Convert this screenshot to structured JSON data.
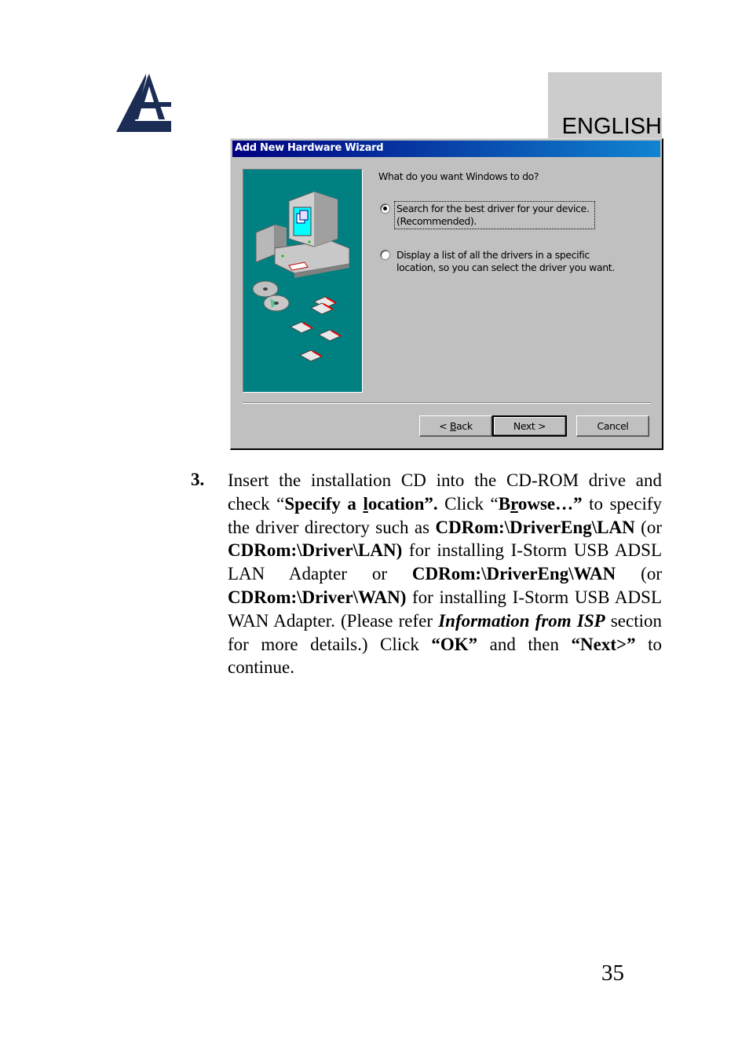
{
  "header": {
    "logo": "atlantis-logo",
    "language_tab": "ENGLISH"
  },
  "dialog": {
    "title": "Add New Hardware Wizard",
    "question": "What do you want Windows to do?",
    "options": [
      {
        "line1": "Search for the best driver for your device.",
        "line2": "(Recommended).",
        "selected": true
      },
      {
        "line1": "Display a list of all the drivers in a specific",
        "line2": "location, so you can select the driver you want.",
        "selected": false
      }
    ],
    "buttons": {
      "back_prefix": "< ",
      "back_accel": "B",
      "back_rest": "ack",
      "next": "Next >",
      "cancel": "Cancel"
    }
  },
  "step": {
    "number": "3.",
    "segments": {
      "s1": "Insert the installation CD into the CD-ROM drive and check “",
      "s2a": "Specify a ",
      "s2u": "l",
      "s2b": "ocation”.",
      "s3": " Click “",
      "s4a": "B",
      "s4u": "r",
      "s4b": "owse…”",
      "s5": " to specify the driver directory such as ",
      "s6": "CDRom:\\DriverEng\\LAN",
      "s7": " (or ",
      "s8": "CDRom:\\Driver\\LAN)",
      "s9": " for installing I-Storm USB ADSL LAN Adapter or ",
      "s10": "CDRom:\\DriverEng\\WAN",
      "s11": " (or ",
      "s12": "CDRom:\\Driver\\WAN)",
      "s13": " for installing I-Storm USB ADSL WAN Adapter. (Please refer ",
      "s14": "Information from ISP",
      "s15": " section for more details.) Click ",
      "s16": "“OK”",
      "s17": " and then ",
      "s18": "“Next>”",
      "s19": " to continue."
    }
  },
  "footer": {
    "page_number": "35"
  }
}
